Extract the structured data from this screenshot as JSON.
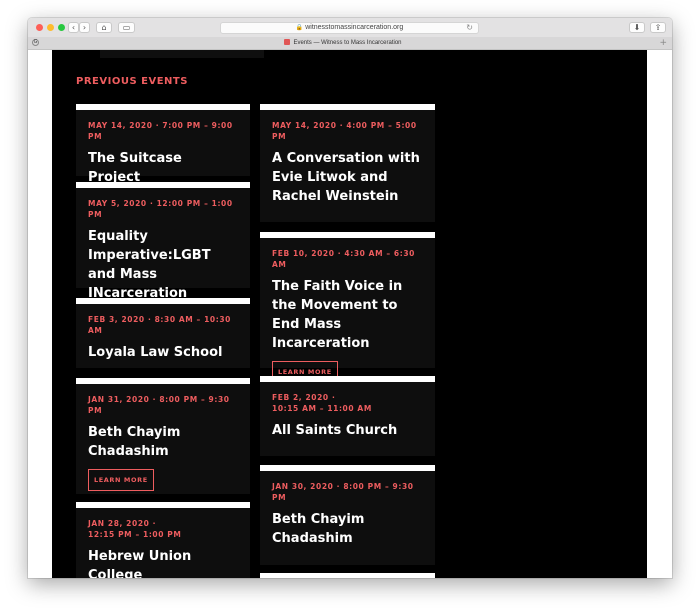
{
  "browser": {
    "url": "witnesstomassincarceration.org",
    "tab_title": "Events — Witness to Mass Incarceration",
    "colors": {
      "close": "#fe5f57",
      "minimize": "#febc2e",
      "zoom": "#28c840"
    }
  },
  "page": {
    "section_heading": "PREVIOUS EVENTS",
    "learn_more_label": "LEARN MORE",
    "accent_color": "#ee5d5f",
    "left_column": [
      {
        "date": "MAY 14, 2020  ·  7:00 PM – 9:00 PM",
        "title": "The Suitcase Project"
      },
      {
        "date": "MAY 5, 2020  ·  12:00 PM – 1:00 PM",
        "title": "Equality Imperative:LGBT and Mass INcarceration"
      },
      {
        "date": "FEB 3, 2020  ·  8:30 AM – 10:30 AM",
        "title": "Loyala Law School"
      },
      {
        "date": "JAN 31, 2020  ·  8:00 PM – 9:30 PM",
        "title": "Beth Chayim Chadashim"
      },
      {
        "date_line1": "JAN 28, 2020  ·",
        "date_line2": "12:15 PM – 1:00 PM",
        "title": "Hebrew Union College"
      }
    ],
    "right_column": [
      {
        "date": "MAY 14, 2020  ·  4:00 PM – 5:00 PM",
        "title": "A Conversation with Evie Litwok and Rachel Weinstein"
      },
      {
        "date": "FEB 10, 2020  ·  4:30 AM – 6:30 AM",
        "title": "The Faith Voice in the Movement to End Mass Incarceration"
      },
      {
        "date_line1": "FEB 2, 2020  ·",
        "date_line2": "10:15 AM – 11:00 AM",
        "title": "All Saints Church"
      },
      {
        "date": "JAN 30, 2020  ·  8:00 PM – 9:30 PM",
        "title": "Beth Chayim Chadashim"
      }
    ]
  }
}
